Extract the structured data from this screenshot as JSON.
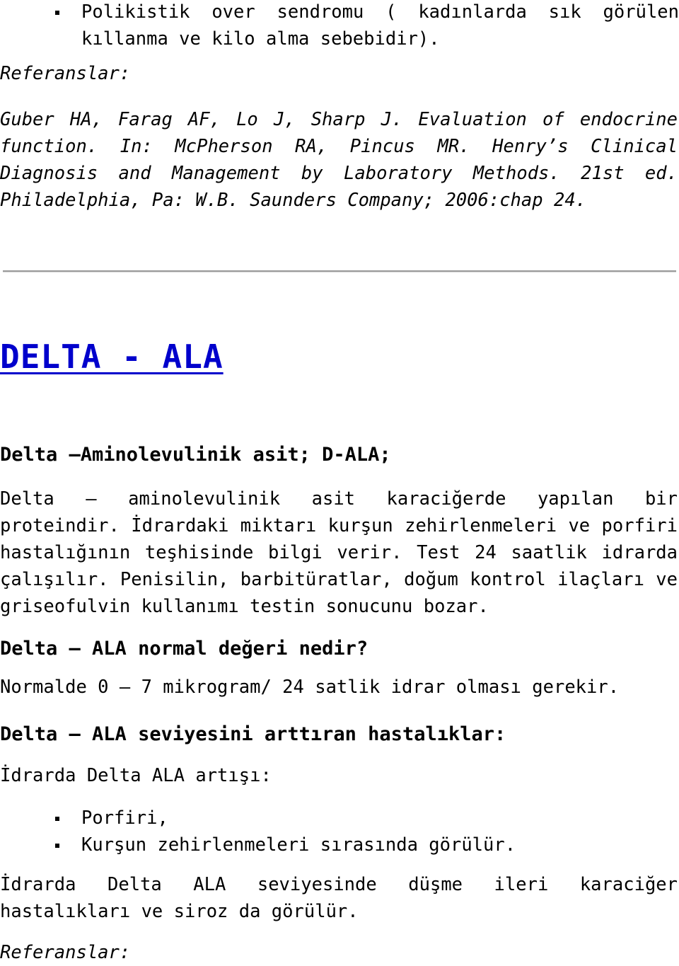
{
  "document": {
    "language": "tr",
    "top_bullets": [
      "Polikistik over sendromu ( kadınlarda sık görülen kıllanma ve kilo alma sebebidir)."
    ],
    "references_label_top": "Referanslar:",
    "reference_top": "Guber HA, Farag AF, Lo J, Sharp J. Evaluation of endocrine function. In: McPherson RA, Pincus MR. Henry’s Clinical Diagnosis and Management by Laboratory Methods. 21st ed. Philadelphia, Pa: W.B. Saunders Company; 2006:chap 24.",
    "section": {
      "link_title": "DELTA - ALA",
      "subtitle": "Delta –Aminolevulinik asit; D-ALA;",
      "intro_paragraph": "Delta – aminolevulinik asit karaciğerde yapılan bir proteindir. İdrardaki miktarı kurşun zehirlenmeleri ve porfiri hastalığının teşhisinde bilgi verir. Test 24 saatlik idrarda çalışılır. Penisilin, barbitüratlar, doğum kontrol ilaçları ve griseofulvin kullanımı testin sonucunu bozar.",
      "normal_heading": "Delta – ALA normal değeri nedir?",
      "normal_value_text": "Normalde 0 – 7 mikrogram/ 24 satlik idrar olması gerekir.",
      "increase_heading": "Delta – ALA seviyesini arttıran hastalıklar:",
      "increase_lead": "İdrarda Delta ALA artışı:",
      "increase_bullets": [
        "Porfiri,",
        "Kurşun zehirlenmeleri sırasında görülür."
      ],
      "decrease_paragraph": "İdrarda Delta ALA seviyesinde düşme ileri karaciğer hastalıkları ve siroz da görülür.",
      "references_label_bottom": "Referanslar:"
    },
    "colors": {
      "link": "#0000cc",
      "text": "#000000",
      "rule": "#9a9a9a",
      "background": "#ffffff"
    }
  }
}
